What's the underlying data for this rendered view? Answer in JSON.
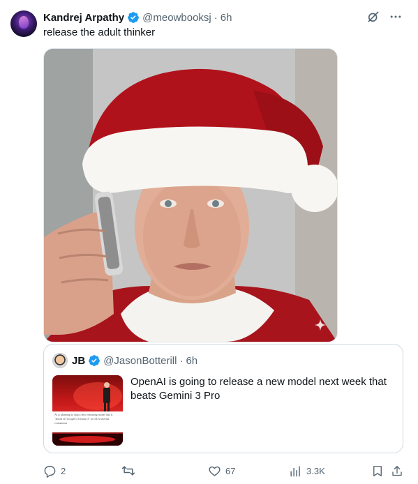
{
  "tweet": {
    "author_name": "Kandrej Arpathy",
    "handle": "@meowbooksj",
    "separator": "·",
    "time": "6h",
    "text": "release the adult thinker"
  },
  "quote": {
    "author_name": "JB",
    "handle": "@JasonBotterill",
    "separator": "·",
    "time": "6h",
    "text": "OpenAI is going to release a new model next week that beats Gemini 3 Pro",
    "thumbnail_caption": "AI is planning to ship a new reasoning model that is \"ahead of [Google's] Gemini 3\" in OAI's internal evaluations"
  },
  "actions": {
    "replies": "2",
    "likes": "67",
    "views": "3.3K"
  },
  "colors": {
    "verified_blue": "#1d9bf0",
    "muted_gray": "#536471",
    "border": "#cfd9de"
  },
  "icons": [
    "grok-icon",
    "more-icon",
    "verified-badge-icon",
    "reply-icon",
    "retweet-icon",
    "like-icon",
    "views-icon",
    "bookmark-icon",
    "share-icon",
    "sparkle-icon"
  ]
}
